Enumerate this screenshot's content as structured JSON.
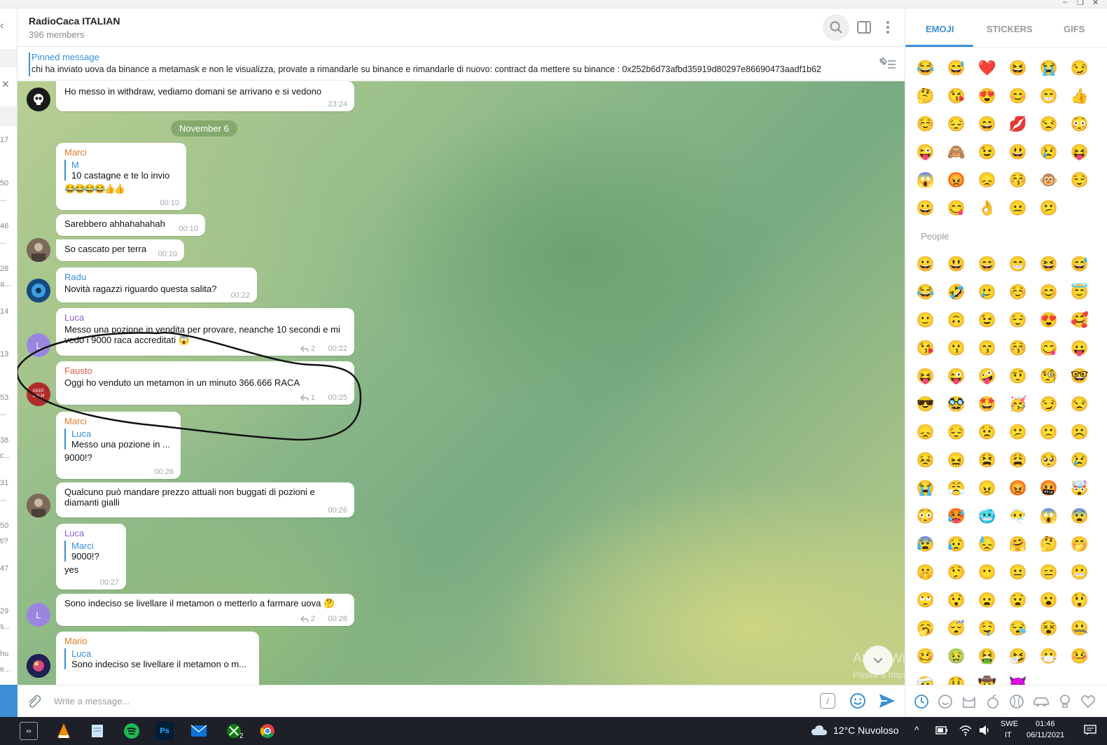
{
  "window": {
    "left_labels": [
      "17",
      "50",
      "...",
      "46",
      "...",
      "28",
      "a...",
      "14",
      "13",
      "53",
      "...",
      "38",
      "c...",
      "31",
      "...",
      "50",
      "ti?",
      "47",
      "29",
      "s...",
      "hu",
      "e..."
    ]
  },
  "header": {
    "title": "RadioCaca ITALIAN",
    "members": "396 members"
  },
  "pinned": {
    "title": "Pinned message",
    "text": "chi ha inviato uova da binance a metamask e non le visualizza, provate a rimandarle su binance e rimandarle di nuovo: contract da mettere su binance : 0x252b6d73afbd35919d80297e86690473aadf1b62"
  },
  "chat": {
    "date_pill": "November 6",
    "messages": [
      {
        "text": "Ho messo in withdraw, vediamo domani se arrivano e si vedono",
        "time": "23:24"
      },
      {
        "author": "Marci",
        "quote_author": "M",
        "quote_text": "10 castagne e te lo invio",
        "text": "😂😂😂😂👍👍",
        "time": "00:10"
      },
      {
        "text": "Sarebbero ahhahahahah",
        "time": "00:10"
      },
      {
        "text": "So cascato per terra",
        "time": "00:10"
      },
      {
        "author": "Radu",
        "text": "Novità ragazzi riguardo questa salita?",
        "time": "00:22"
      },
      {
        "author": "Luca",
        "text_line1": "Messo una pozione in vendita per provare, neanche 10 secondi e mi",
        "text_line2": "vedo i 9000 raca accreditati 😱",
        "replies": "2",
        "time": "00:22"
      },
      {
        "author": "Fausto",
        "text": "Oggi ho venduto un metamon in un minuto 366.666 RACA",
        "replies": "1",
        "time": "00:25"
      },
      {
        "author": "Marci",
        "quote_author": "Luca",
        "quote_text": "Messo una pozione in ...",
        "text": "9000!?",
        "time": "00:26"
      },
      {
        "text_line1": "Qualcuno può mandare prezzo attuali non buggati di pozioni e",
        "text_line2": "diamanti gialli",
        "time": "00:26"
      },
      {
        "author": "Luca",
        "quote_author": "Marci",
        "quote_text": "9000!?",
        "text": "yes",
        "time": "00:27"
      },
      {
        "text": "Sono indeciso se livellare il metamon o metterlo a farmare uova 🤔",
        "replies": "2",
        "time": "00:28"
      },
      {
        "author": "Mario",
        "quote_author": "Luca",
        "quote_text": "Sono indeciso se livellare il metamon o m..."
      }
    ],
    "avatars": {
      "luca": "L",
      "keepcalm": "KEEP CALM"
    },
    "watermark_title": "Attiva Windows",
    "watermark_sub": "Passa a Impostazioni per attivare Windows."
  },
  "input": {
    "placeholder": "Write a message...",
    "cmd_symbol": "/"
  },
  "emoji_panel": {
    "tabs": [
      "EMOJI",
      "STICKERS",
      "GIFS"
    ],
    "active_tab": "EMOJI",
    "recent": [
      "😂",
      "😅",
      "❤️",
      "😆",
      "😭",
      "😏",
      "🤔",
      "😘",
      "😍",
      "😊",
      "😁",
      "👍",
      "☺️",
      "😔",
      "😄",
      "💋",
      "😒",
      "😳",
      "😜",
      "🙈",
      "😉",
      "😃",
      "😢",
      "😝",
      "😱",
      "😡",
      "😞",
      "😚",
      "🐵",
      "😌",
      "😀",
      "😋",
      "👌",
      "😐",
      "😕"
    ],
    "category_people": "People",
    "people": [
      "😀",
      "😃",
      "😄",
      "😁",
      "😆",
      "😅",
      "😂",
      "🤣",
      "🥲",
      "☺️",
      "😊",
      "😇",
      "🙂",
      "🙃",
      "😉",
      "😌",
      "😍",
      "🥰",
      "😘",
      "😗",
      "😙",
      "😚",
      "😋",
      "😛",
      "😝",
      "😜",
      "🤪",
      "🤨",
      "🧐",
      "🤓",
      "😎",
      "🥸",
      "🤩",
      "🥳",
      "😏",
      "😒",
      "😞",
      "😔",
      "😟",
      "😕",
      "🙁",
      "☹️",
      "😣",
      "😖",
      "😫",
      "😩",
      "🥺",
      "😢",
      "😭",
      "😤",
      "😠",
      "😡",
      "🤬",
      "🤯",
      "😳",
      "🥵",
      "🥶",
      "😶‍🌫️",
      "😱",
      "😨",
      "😰",
      "😥",
      "😓",
      "🤗",
      "🤔",
      "🤭",
      "🤫",
      "🤥",
      "😶",
      "😐",
      "😑",
      "😬",
      "🙄",
      "😯",
      "😦",
      "😧",
      "😮",
      "😲",
      "🥱",
      "😴",
      "🤤",
      "😪",
      "😵",
      "🤐",
      "🥴",
      "🤢",
      "🤮",
      "🤧",
      "😷",
      "🤒",
      "🤕",
      "🤑",
      "🤠",
      "😈"
    ]
  },
  "taskbar": {
    "weather": "12°C  Nuvoloso",
    "lang_top": "SWE",
    "lang_bottom": "IT",
    "time": "01:46",
    "date": "06/11/2021",
    "xbox_badge": "2",
    "ps_label": "Ps"
  },
  "colors": {
    "accent": "#3a8fd6",
    "author_marci": "#e07b2a",
    "author_luca": "#8d5fd3",
    "author_radu": "#3a8fd6",
    "author_fausto": "#d8584a",
    "author_mario": "#e07b2a"
  }
}
